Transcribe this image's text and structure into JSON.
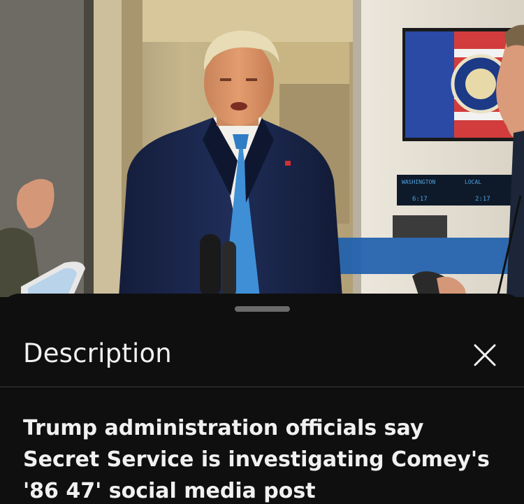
{
  "video": {
    "scene": "press-gaggle-aboard-aircraft",
    "clock_labels": [
      "WASHINGTON",
      "LOCAL"
    ],
    "clock_times": [
      "6:17",
      "2:17"
    ],
    "colors": {
      "cabin_wall": "#d9c9a0",
      "suit": "#1c2a52",
      "tie": "#3f8fd6",
      "lower_third_bar": "#1f5fae"
    }
  },
  "sheet": {
    "title": "Description",
    "close_icon": "close-icon",
    "video_title": "Trump administration officials say Secret Service is investigating Comey's '86 47' social media post"
  },
  "theme": {
    "background": "#0f0f0f",
    "text": "#f1f1f1",
    "divider": "#3a3a3a",
    "handle": "#6b6b6b"
  }
}
